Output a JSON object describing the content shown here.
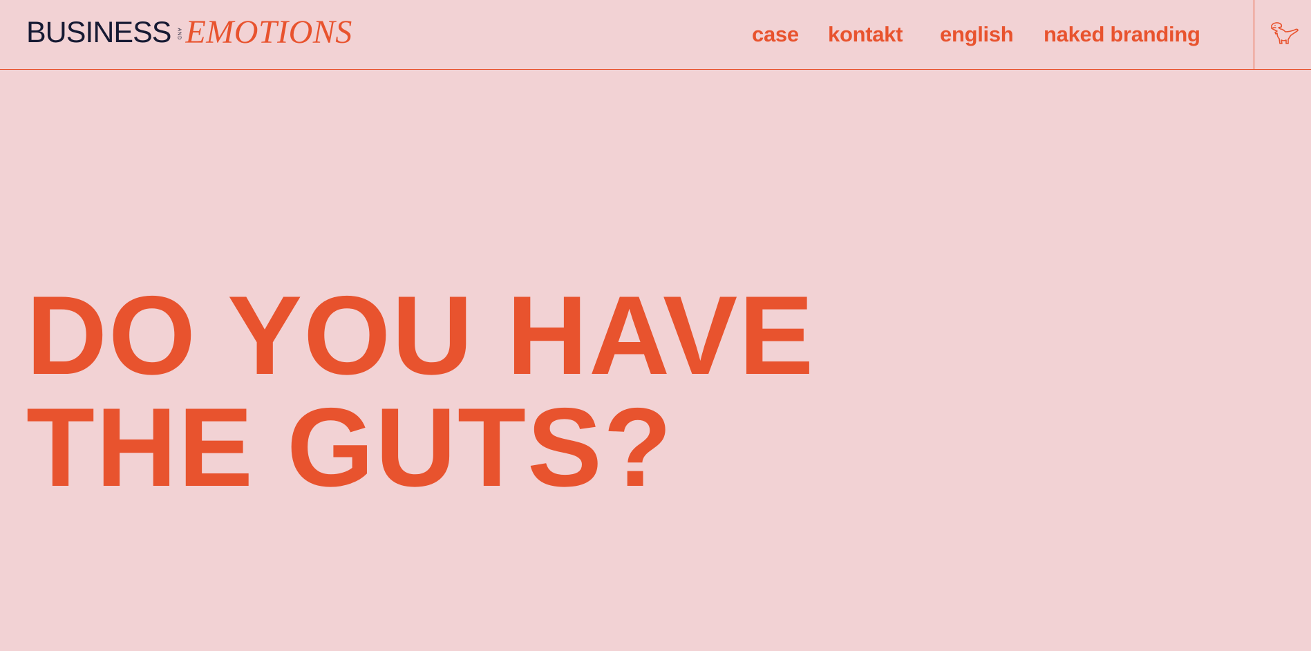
{
  "brand": {
    "left_word": "BUSINESS",
    "connector": "AND",
    "right_word": "EMOTIONS"
  },
  "nav": {
    "items": [
      {
        "label": "case"
      },
      {
        "label": "kontakt"
      },
      {
        "label": "english"
      },
      {
        "label": "naked branding"
      }
    ]
  },
  "hero": {
    "line1": "DO YOU HAVE",
    "line2": "THE GUTS?"
  },
  "icons": {
    "menu_logo": "dinosaur-icon"
  },
  "colors": {
    "background": "#f2d2d4",
    "accent": "#e8532e",
    "brand_dark": "#161a33"
  }
}
